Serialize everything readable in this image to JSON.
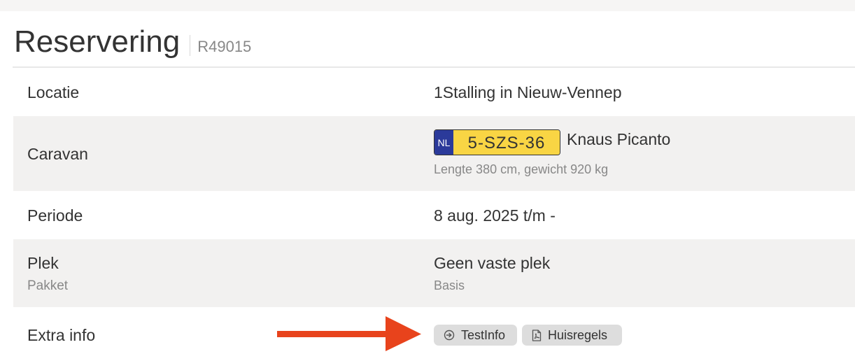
{
  "header": {
    "title": "Reservering",
    "reference": "R49015"
  },
  "rows": {
    "locatie": {
      "label": "Locatie",
      "value": "1Stalling in Nieuw-Vennep"
    },
    "caravan": {
      "label": "Caravan",
      "plate_country": "NL",
      "plate_number": "5-SZS-36",
      "name": "Knaus Picanto",
      "details": "Lengte 380 cm, gewicht 920 kg"
    },
    "periode": {
      "label": "Periode",
      "value": "8 aug. 2025 t/m -"
    },
    "plek": {
      "label": "Plek",
      "sublabel": "Pakket",
      "value": "Geen vaste plek",
      "subvalue": "Basis"
    },
    "extra_info": {
      "label": "Extra info",
      "buttons": [
        {
          "label": "TestInfo",
          "icon": "arrow-circle-right-icon"
        },
        {
          "label": "Huisregels",
          "icon": "pdf-file-icon"
        }
      ]
    }
  },
  "colors": {
    "plate_yellow": "#f9d544",
    "plate_blue": "#2b3a9a",
    "annotation_arrow": "#e8431c",
    "row_alt_bg": "#f2f1f0",
    "chip_bg": "#dddddd"
  }
}
